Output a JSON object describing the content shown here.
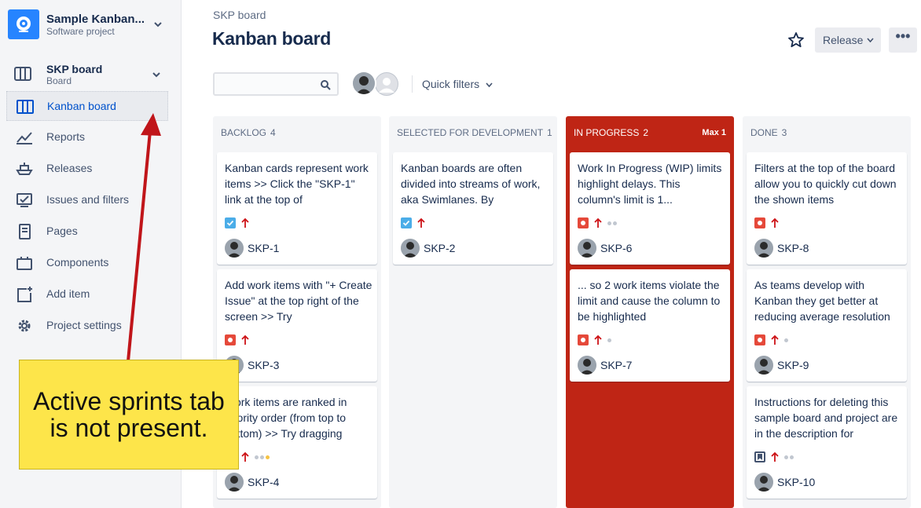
{
  "sidebar": {
    "project_name": "Sample Kanban...",
    "project_type": "Software project",
    "board_name": "SKP board",
    "board_type": "Board",
    "items": [
      {
        "label": "Kanban board",
        "icon": "board-icon",
        "active": true
      },
      {
        "label": "Reports",
        "icon": "reports-icon"
      },
      {
        "label": "Releases",
        "icon": "ship-icon"
      },
      {
        "label": "Issues and filters",
        "icon": "issues-icon"
      },
      {
        "label": "Pages",
        "icon": "page-icon"
      },
      {
        "label": "Components",
        "icon": "components-icon"
      },
      {
        "label": "Add item",
        "icon": "add-item-icon"
      },
      {
        "label": "Project settings",
        "icon": "gear-icon"
      }
    ]
  },
  "header": {
    "breadcrumb": "SKP board",
    "title": "Kanban board",
    "release_label": "Release",
    "more_label": "•••",
    "search_value": "",
    "quick_filters_label": "Quick filters"
  },
  "columns": [
    {
      "title": "BACKLOG",
      "count": "4",
      "cards": [
        {
          "text": "Kanban cards represent work items >> Click the \"SKP-1\" link at the top of",
          "key": "SKP-1",
          "type": "task",
          "dots": 0
        },
        {
          "text": "Add work items with \"+ Create Issue\" at the top right of the screen >> Try",
          "key": "SKP-3",
          "type": "bug",
          "dots": 0
        },
        {
          "text": "Work items are ranked in priority order (from top to bottom) >> Try dragging",
          "key": "SKP-4",
          "type": "bug",
          "dots": 3
        }
      ]
    },
    {
      "title": "SELECTED FOR DEVELOPMENT",
      "count": "1",
      "cards": [
        {
          "text": "Kanban boards are often divided into streams of work, aka Swimlanes. By",
          "key": "SKP-2",
          "type": "task",
          "dots": 0
        }
      ]
    },
    {
      "title": "IN PROGRESS",
      "count": "2",
      "max": "Max 1",
      "cards": [
        {
          "text": "Work In Progress (WIP) limits highlight delays. This column's limit is 1...",
          "key": "SKP-6",
          "type": "bug",
          "dots": 2
        },
        {
          "text": "... so 2 work items violate the limit and cause the column to be highlighted",
          "key": "SKP-7",
          "type": "bug",
          "dots": 1
        }
      ]
    },
    {
      "title": "DONE",
      "count": "3",
      "cards": [
        {
          "text": "Filters at the top of the board allow you to quickly cut down the shown items",
          "key": "SKP-8",
          "type": "bug",
          "dots": 0
        },
        {
          "text": "As teams develop with Kanban they get better at reducing average resolution",
          "key": "SKP-9",
          "type": "bug",
          "dots": 1
        },
        {
          "text": "Instructions for deleting this sample board and project are in the description for",
          "key": "SKP-10",
          "type": "story2",
          "dots": 2
        }
      ]
    }
  ],
  "annotation": {
    "text": "Active sprints tab is not present."
  },
  "colors": {
    "accent": "#0052cc",
    "wip_column": "#bf2515",
    "arrow": "#c0151a",
    "note": "#fde54a",
    "priority": "#cd1317"
  }
}
